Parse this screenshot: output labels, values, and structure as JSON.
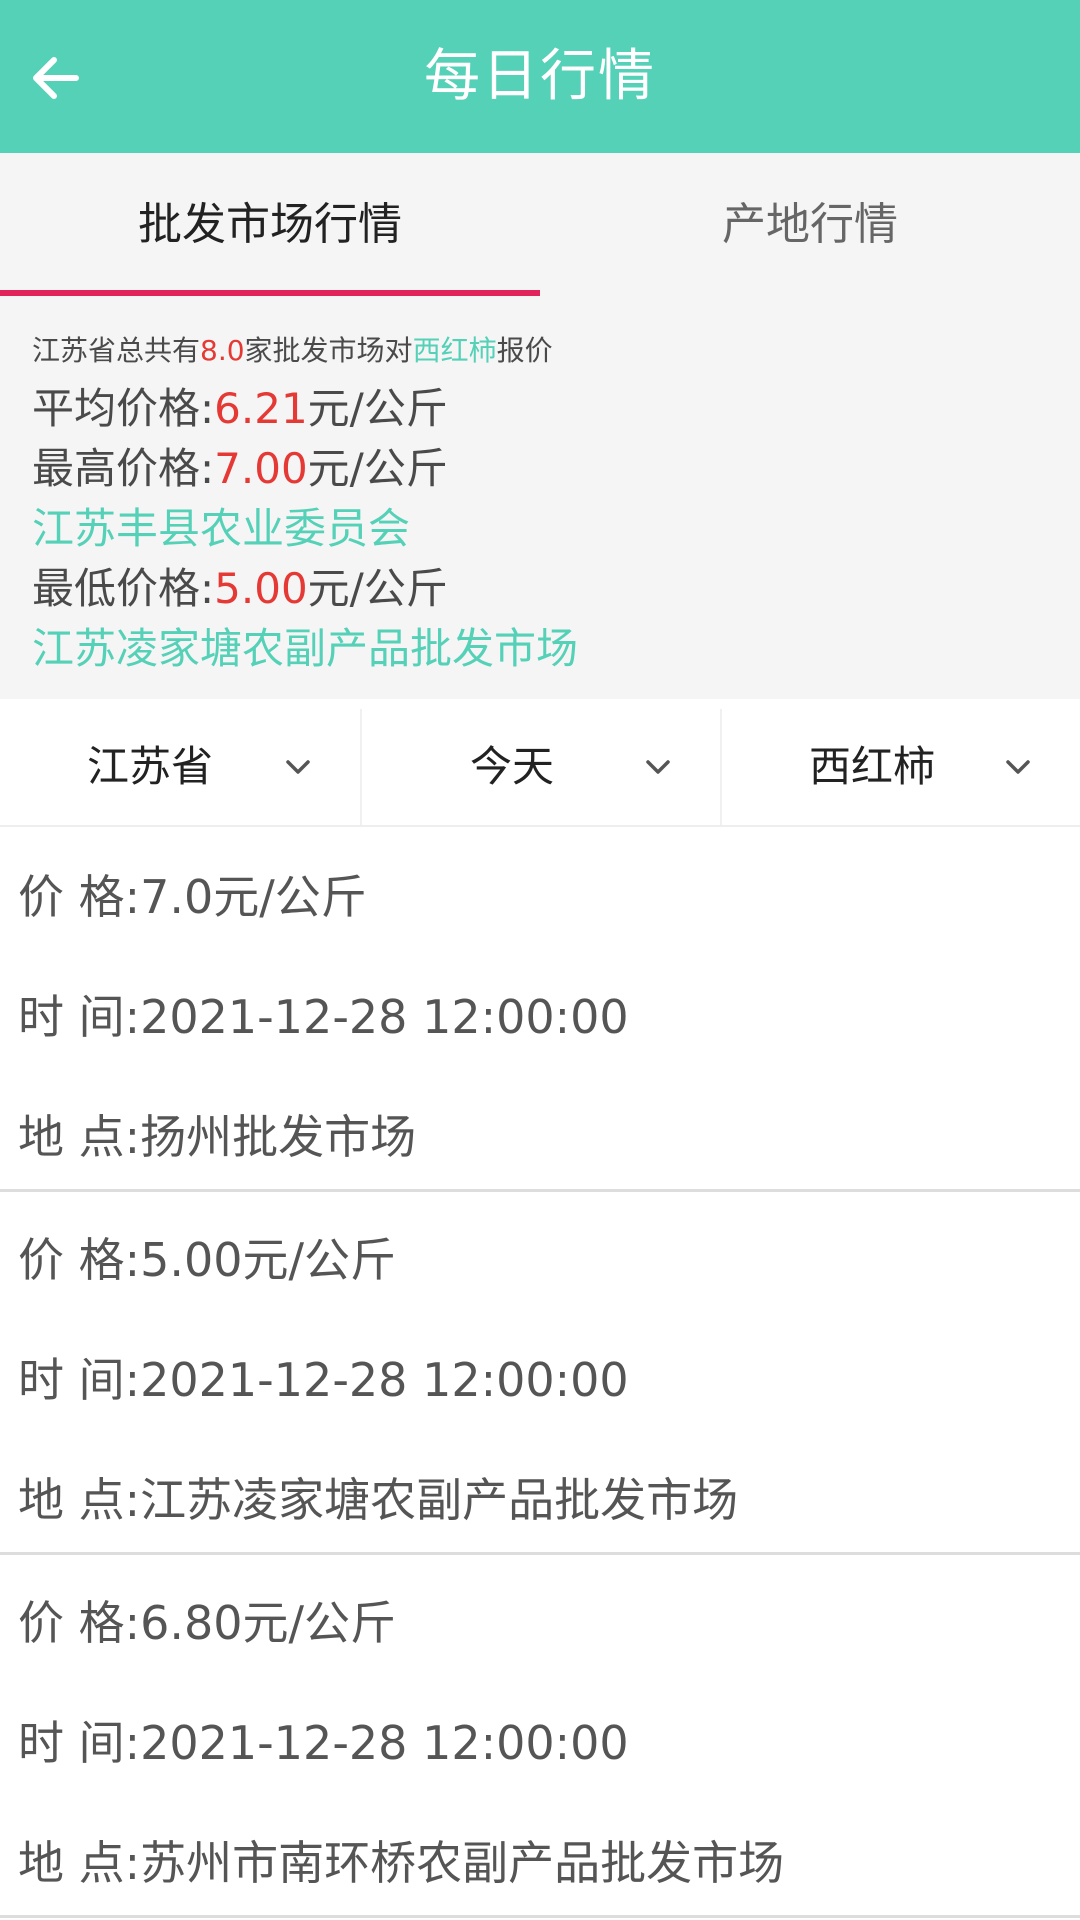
{
  "header": {
    "title": "每日行情"
  },
  "tabs": [
    {
      "label": "批发市场行情",
      "active": true
    },
    {
      "label": "产地行情",
      "active": false
    }
  ],
  "summary": {
    "line1_prefix": "江苏省总共有",
    "market_count": "8.0",
    "line1_mid": "家批发市场对",
    "product": "西红柿",
    "line1_suffix": "报价",
    "avg_label": "平均价格:",
    "avg_value": "6.21",
    "max_label": "最高价格:",
    "max_value": "7.00",
    "max_market": "江苏丰县农业委员会",
    "min_label": "最低价格:",
    "min_value": "5.00",
    "min_market": "江苏凌家塘农副产品批发市场",
    "unit": "元/公斤"
  },
  "filters": [
    {
      "label": "江苏省",
      "icon": "chevron-down-icon"
    },
    {
      "label": "今天",
      "icon": "chevron-down-icon"
    },
    {
      "label": "西红柿",
      "icon": "chevron-down-icon"
    }
  ],
  "records": [
    {
      "price": "价 格:7.0元/公斤",
      "time": "时 间:2021-12-28 12:00:00",
      "place": "地 点:扬州批发市场"
    },
    {
      "price": "价 格:5.00元/公斤",
      "time": "时 间:2021-12-28 12:00:00",
      "place": "地 点:江苏凌家塘农副产品批发市场"
    },
    {
      "price": "价 格:6.80元/公斤",
      "time": "时 间:2021-12-28 12:00:00",
      "place": "地 点:苏州市南环桥农副产品批发市场"
    }
  ],
  "colors": {
    "accent": "#54d1b7",
    "tab_indicator": "#e1245b",
    "price_red": "#e53935"
  }
}
